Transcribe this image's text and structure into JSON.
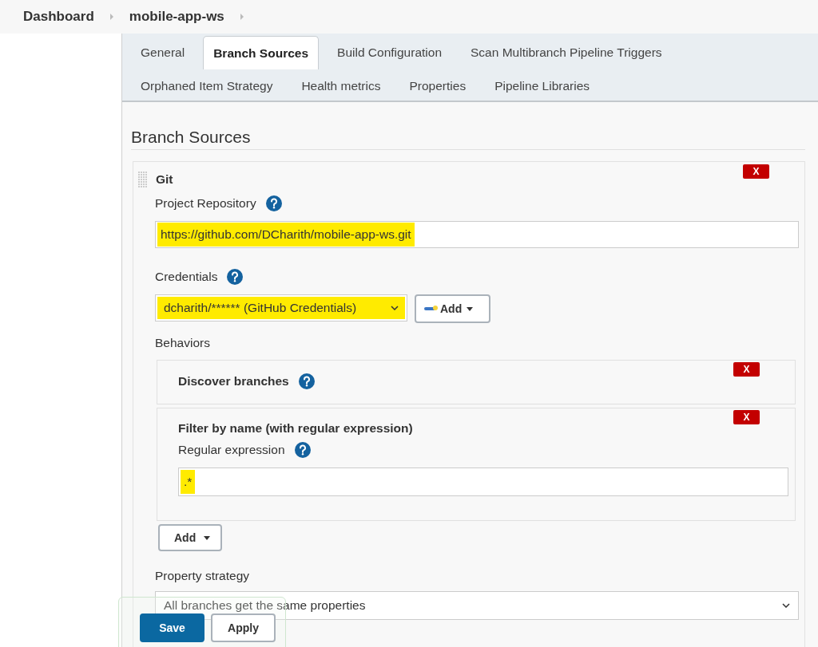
{
  "breadcrumbs": [
    {
      "label": "Dashboard"
    },
    {
      "label": "mobile-app-ws"
    }
  ],
  "tabs": [
    [
      {
        "label": "General",
        "selected": false
      },
      {
        "label": "Branch Sources",
        "selected": true
      },
      {
        "label": "Build Configuration",
        "selected": false
      },
      {
        "label": "Scan Multibranch Pipeline Triggers",
        "selected": false
      }
    ],
    [
      {
        "label": "Orphaned Item Strategy",
        "selected": false
      },
      {
        "label": "Health metrics",
        "selected": false
      },
      {
        "label": "Properties",
        "selected": false
      },
      {
        "label": "Pipeline Libraries",
        "selected": false
      }
    ]
  ],
  "section_title": "Branch Sources",
  "source": {
    "title": "Git",
    "delete_label": "X",
    "fields": [
      {
        "kind": "text",
        "label": "Project Repository",
        "value": "https://github.com/DCharith/mobile-app-ws.git",
        "highlighted": true
      },
      {
        "kind": "select",
        "label": "Credentials",
        "value": "dcharith/****** (GitHub Credentials)",
        "highlighted": true,
        "add_label": "Add"
      }
    ],
    "behaviors_label": "Behaviors",
    "behaviors": [
      {
        "title": "Discover branches",
        "delete_label": "X"
      },
      {
        "title": "Filter by name (with regular expression)",
        "delete_label": "X",
        "field": {
          "label": "Regular expression",
          "value": ".*",
          "highlighted": true
        }
      }
    ],
    "add_label": "Add",
    "property_strategy": {
      "label": "Property strategy",
      "value": "All branches get the same properties"
    }
  },
  "actions": [
    {
      "label": "Save",
      "kind": "primary"
    },
    {
      "label": "Apply",
      "kind": "secondary"
    }
  ]
}
